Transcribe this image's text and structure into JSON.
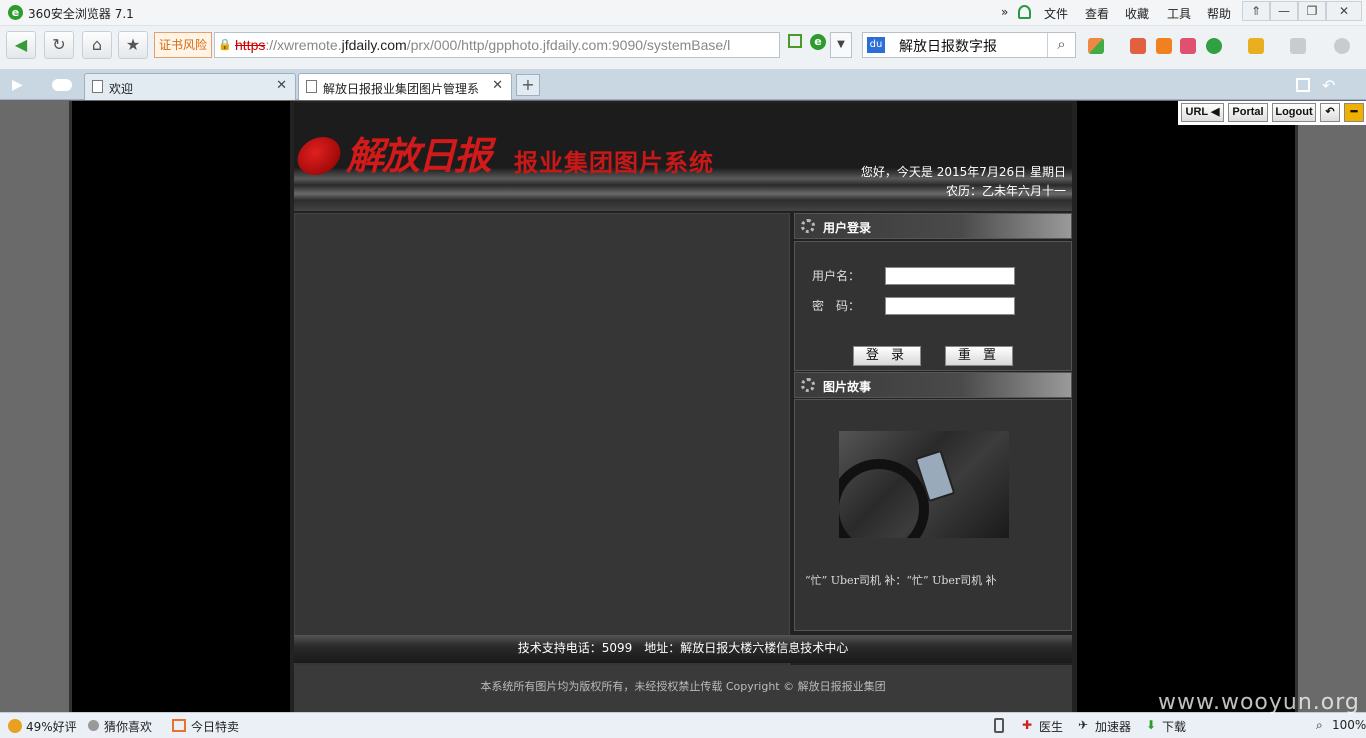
{
  "browser": {
    "title": "360安全浏览器 7.1",
    "menu": [
      "文件",
      "查看",
      "收藏",
      "工具",
      "帮助"
    ],
    "window_buttons": [
      "⇑",
      "—",
      "❐",
      "✕"
    ],
    "cert_warning": "证书风险",
    "url": {
      "scheme": "https",
      "sep": "://xwremote.",
      "domain": "jfdaily.com",
      "rest": "/prx/000/http/gpphoto.jfdaily.com:9090/systemBase/l"
    },
    "search_text": "解放日报数字报",
    "tabs": [
      {
        "label": "欢迎",
        "active": false
      },
      {
        "label": "解放日报报业集团图片管理系",
        "active": true
      }
    ],
    "status_items": [
      "49%好评",
      "猜你喜欢",
      "今日特卖"
    ],
    "status_right": [
      "医生",
      "加速器",
      "下载",
      "100%"
    ]
  },
  "float_buttons": [
    "URL ◀",
    "Portal",
    "Logout"
  ],
  "page": {
    "logo_text": "解放日报",
    "system_title": "报业集团图片系统",
    "greeting": "您好，今天是 2015年7月26日 星期日",
    "lunar": "农历：乙未年六月十一",
    "login": {
      "header": "用户登录",
      "username_label": "用户名：",
      "password_label": "密　码：",
      "login_button": "登 录",
      "reset_button": "重 置"
    },
    "story": {
      "header": "图片故事",
      "caption": "“忙” Uber司机 补：“忙” Uber司机 补"
    },
    "support": "技术支持电话：5099　地址：解放日报大楼六楼信息技术中心",
    "copyright": "本系统所有图片均为版权所有，未经授权禁止传载 Copyright © 解放日报报业集团"
  },
  "watermark": "www.wooyun.org",
  "colors": {
    "accent_red": "#d21a1a",
    "page_bg": "#222222"
  }
}
